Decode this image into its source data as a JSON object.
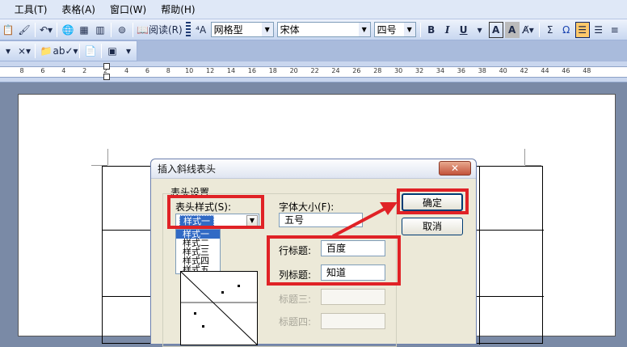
{
  "menubar": {
    "items": [
      ") ",
      "工具(T)",
      "表格(A)",
      "窗口(W)",
      "帮助(H)"
    ]
  },
  "toolbar": {
    "read_label": "阅读(R)",
    "style_value": "网格型",
    "font_value": "宋体",
    "size_value": "四号",
    "bold": "B",
    "italic": "I",
    "underline": "U",
    "charborder": "A",
    "charshade": "A",
    "sigma": "Σ",
    "omega": "Ω"
  },
  "ruler": {
    "numbers": [
      "8",
      "6",
      "4",
      "2",
      "2",
      "4",
      "6",
      "8",
      "10",
      "12",
      "14",
      "16",
      "18",
      "20",
      "22",
      "24",
      "26",
      "28",
      "30",
      "32",
      "34",
      "36",
      "38",
      "40",
      "42",
      "44",
      "46",
      "48"
    ]
  },
  "dialog": {
    "title": "插入斜线表头",
    "close": "✕",
    "group_label": "表头设置",
    "style_label": "表头样式(S):",
    "style_value": "样式一",
    "style_options": [
      "样式一",
      "样式二",
      "样式三",
      "样式四",
      "样式五"
    ],
    "font_size_label": "字体大小(F):",
    "font_size_value": "五号",
    "row_title_label": "行标题:",
    "row_title_value": "百度",
    "col_title_label": "列标题:",
    "col_title_value": "知道",
    "title3_label": "标题三:",
    "title3_value": "",
    "title4_label": "标题四:",
    "title4_value": "",
    "ok": "确定",
    "cancel": "取消"
  },
  "colors": {
    "highlight": "#e02226",
    "selection": "#316ac5"
  }
}
